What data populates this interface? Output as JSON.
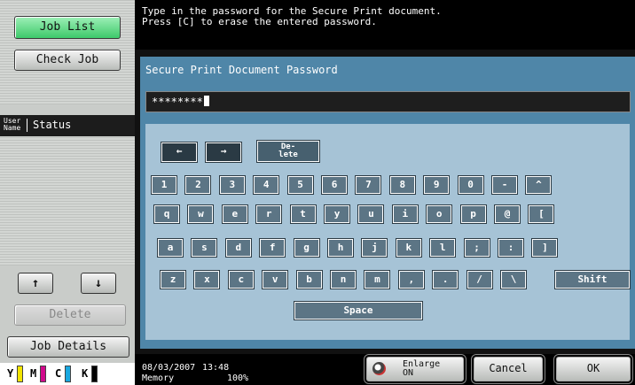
{
  "left_panel": {
    "job_list_label": "Job List",
    "check_job_label": "Check Job",
    "list_header": {
      "user_name": "User Name",
      "status": "Status"
    },
    "up_arrow": "↑",
    "down_arrow": "↓",
    "delete_label": "Delete",
    "job_details_label": "Job Details",
    "toner": [
      {
        "letter": "Y",
        "color": "#f2e400"
      },
      {
        "letter": "M",
        "color": "#d10a8c"
      },
      {
        "letter": "C",
        "color": "#19a8e0"
      },
      {
        "letter": "K",
        "color": "#000000"
      }
    ]
  },
  "message": {
    "line1": "Type in the password for the Secure Print document.",
    "line2": "Press [C] to erase the entered password."
  },
  "dialog": {
    "title": "Secure Print Document Password",
    "password_value": "********"
  },
  "keyboard": {
    "nav": {
      "left": "←",
      "right": "→",
      "delete": "De-\nlete"
    },
    "row1": [
      "1",
      "2",
      "3",
      "4",
      "5",
      "6",
      "7",
      "8",
      "9",
      "0",
      "-",
      "^"
    ],
    "row2": [
      "q",
      "w",
      "e",
      "r",
      "t",
      "y",
      "u",
      "i",
      "o",
      "p",
      "@",
      "["
    ],
    "row3": [
      "a",
      "s",
      "d",
      "f",
      "g",
      "h",
      "j",
      "k",
      "l",
      ";",
      ":",
      "]"
    ],
    "row4": [
      "z",
      "x",
      "c",
      "v",
      "b",
      "n",
      "m",
      ",",
      ".",
      "/",
      "\\"
    ],
    "shift": "Shift",
    "space": "Space"
  },
  "status_bar": {
    "date": "08/03/2007",
    "time": "13:48",
    "memory_label": "Memory",
    "memory_value": "100%",
    "enlarge_label": "Enlarge",
    "enlarge_state": "ON",
    "cancel_label": "Cancel",
    "ok_label": "OK"
  }
}
